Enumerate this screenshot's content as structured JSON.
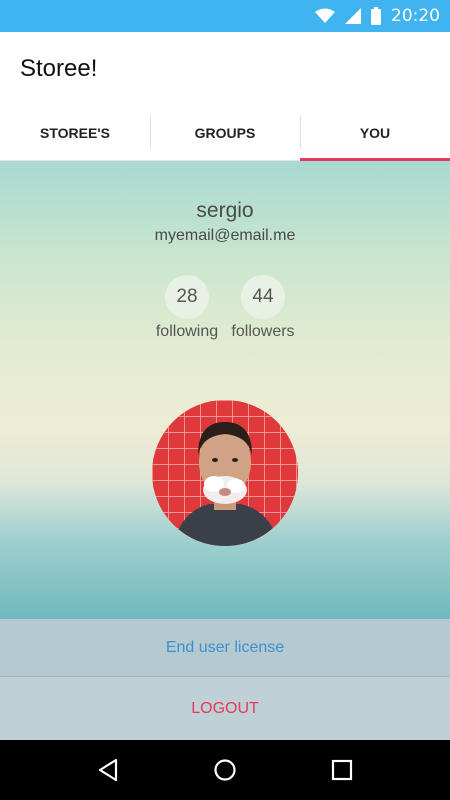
{
  "status_bar": {
    "time": "20:20",
    "icons": [
      "wifi-icon",
      "signal-icon",
      "battery-icon"
    ],
    "color": "#40b4ee"
  },
  "app": {
    "title": "Storee!"
  },
  "tabs": [
    {
      "label": "STOREE'S",
      "active": false
    },
    {
      "label": "GROUPS",
      "active": false
    },
    {
      "label": "YOU",
      "active": true
    }
  ],
  "profile": {
    "username": "sergio",
    "email": "myemail@email.me",
    "following_count": "28",
    "following_label": "following",
    "followers_count": "44",
    "followers_label": "followers",
    "avatar_icon": "profile-photo"
  },
  "actions": {
    "license_label": "End user license",
    "logout_label": "LOGOUT"
  },
  "nav_bar": {
    "icons": [
      "back-icon",
      "home-icon",
      "recents-icon"
    ]
  },
  "colors": {
    "accent": "#e8395a",
    "link": "#3e8fd3"
  }
}
